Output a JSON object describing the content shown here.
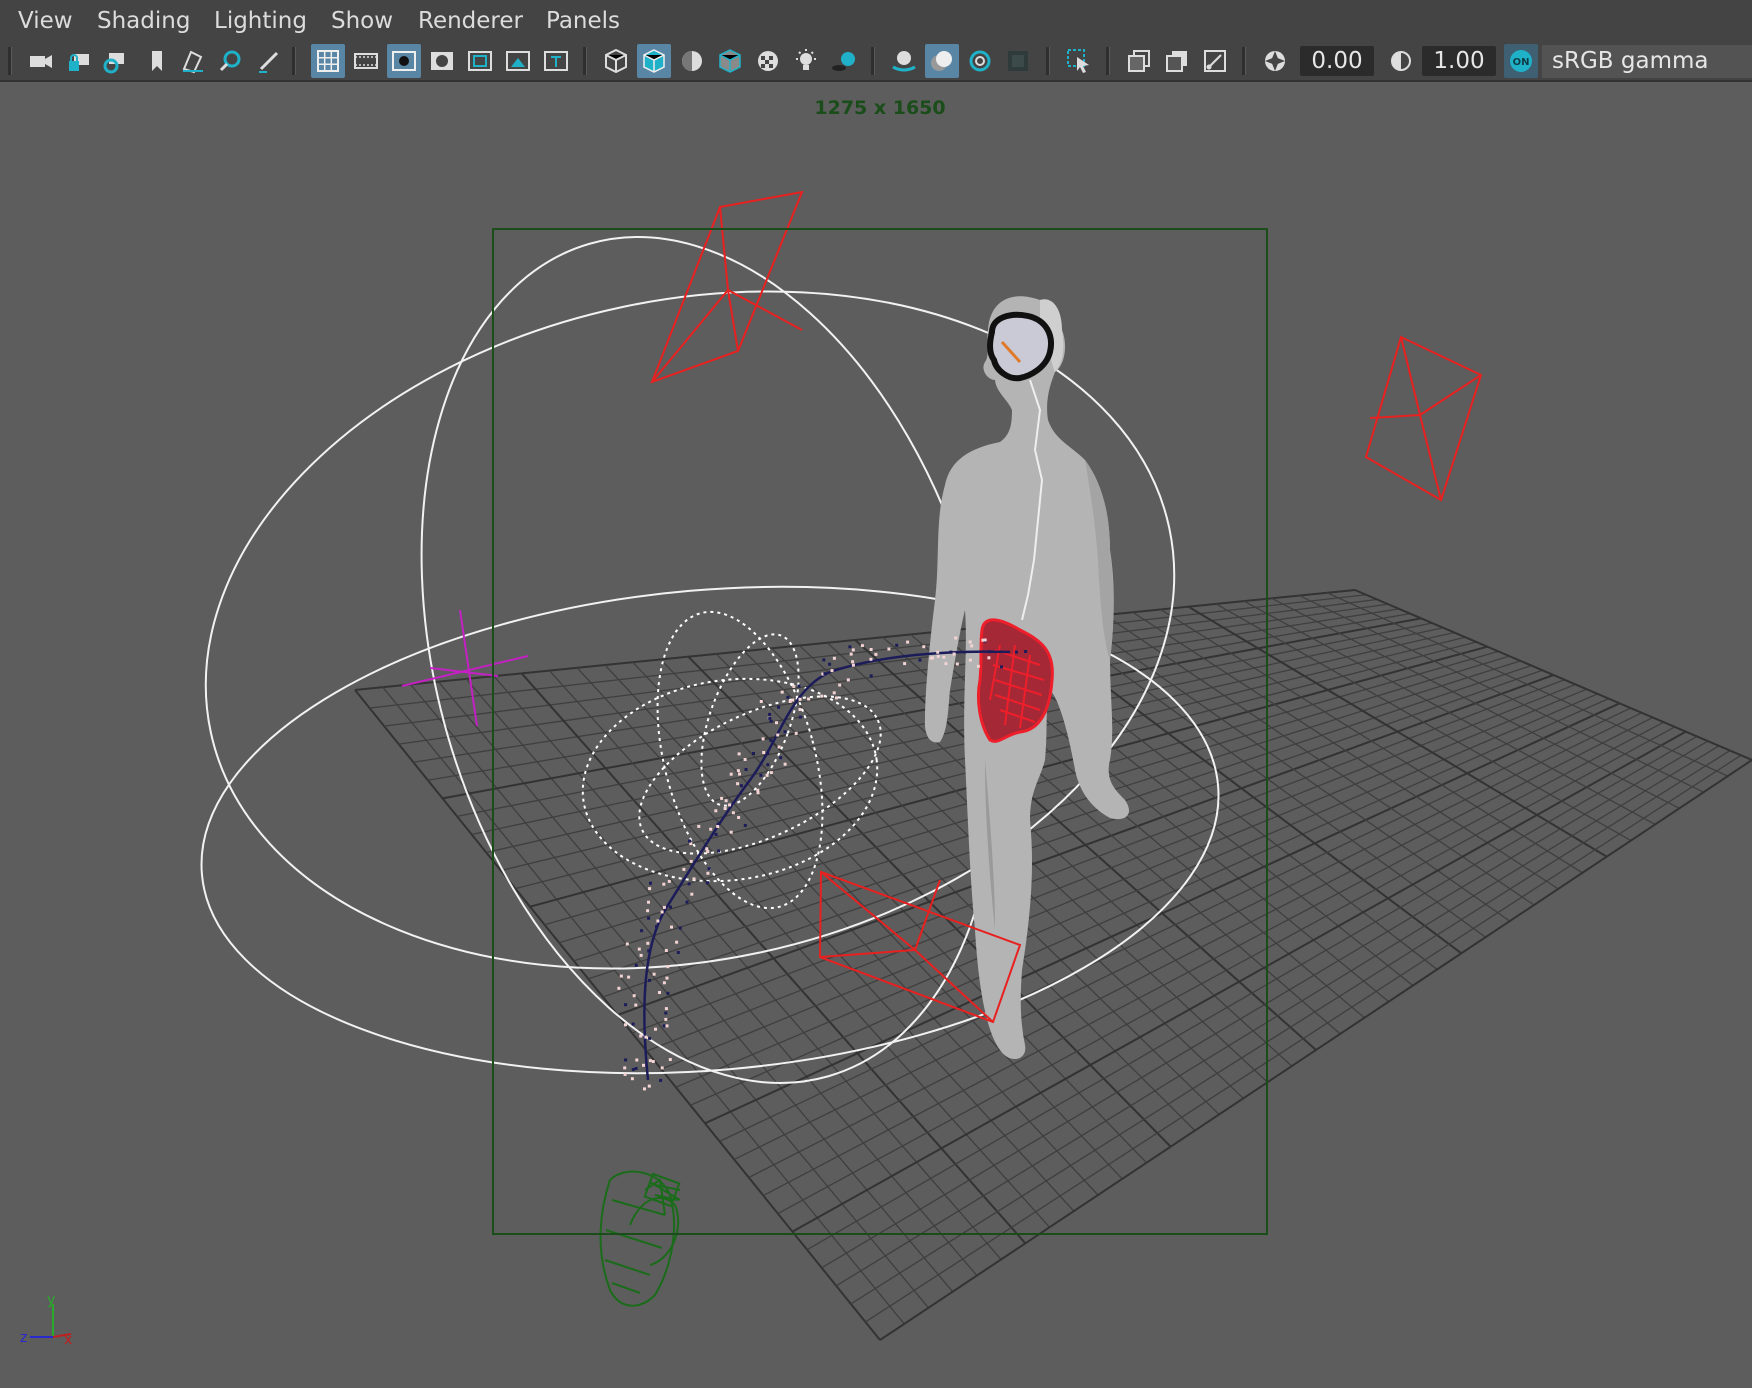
{
  "menu": {
    "items": [
      "View",
      "Shading",
      "Lighting",
      "Show",
      "Renderer",
      "Panels"
    ]
  },
  "toolbar": {
    "exposure_value": "0.00",
    "gamma_value": "1.00",
    "color_space": "sRGB gamma",
    "colors": {
      "active": "#5a86a6",
      "accent": "#1fb1c8"
    }
  },
  "viewport": {
    "resolution_label": "1275 x 1650",
    "axis_labels": {
      "y": "y",
      "z": "z",
      "x": "x"
    }
  }
}
